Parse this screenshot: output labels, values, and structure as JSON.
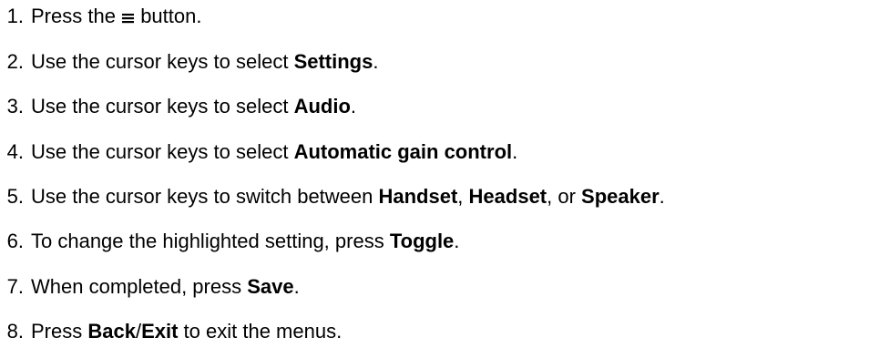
{
  "steps": [
    {
      "number": "1.",
      "parts": [
        "Press the",
        "button."
      ]
    },
    {
      "number": "2.",
      "parts": [
        "Use the cursor keys to select ",
        "Settings",
        "."
      ]
    },
    {
      "number": "3.",
      "parts": [
        "Use the cursor keys to select ",
        "Audio",
        "."
      ]
    },
    {
      "number": "4.",
      "parts": [
        "Use the cursor keys to select ",
        "Automatic gain control",
        "."
      ]
    },
    {
      "number": "5.",
      "parts": [
        "Use the cursor keys to switch between ",
        "Handset",
        ", ",
        "Headset",
        ", or ",
        "Speaker",
        "."
      ]
    },
    {
      "number": "6.",
      "parts": [
        "To change the highlighted setting, press ",
        "Toggle",
        "."
      ]
    },
    {
      "number": "7.",
      "parts": [
        "When completed, press ",
        "Save",
        "."
      ]
    },
    {
      "number": "8.",
      "parts": [
        "Press ",
        "Back",
        "/",
        "Exit",
        " to exit the menus."
      ]
    }
  ],
  "icons": {
    "menu": "menu-icon"
  }
}
